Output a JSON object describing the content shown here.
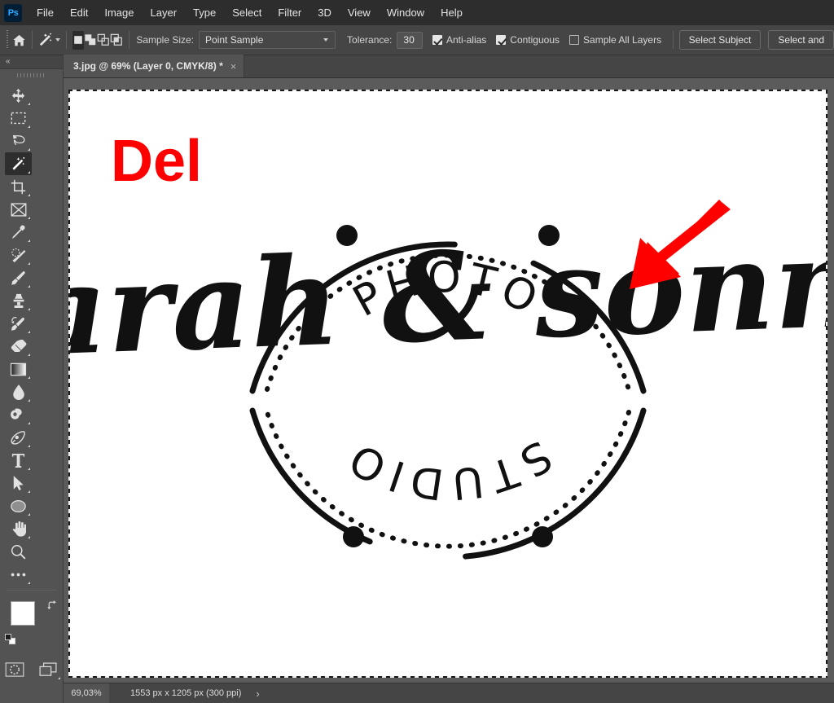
{
  "app": {
    "name": "Adobe Photoshop",
    "logo_text": "Ps"
  },
  "menubar": {
    "items": [
      {
        "label": "File"
      },
      {
        "label": "Edit"
      },
      {
        "label": "Image"
      },
      {
        "label": "Layer"
      },
      {
        "label": "Type"
      },
      {
        "label": "Select"
      },
      {
        "label": "Filter"
      },
      {
        "label": "3D"
      },
      {
        "label": "View"
      },
      {
        "label": "Window"
      },
      {
        "label": "Help"
      }
    ]
  },
  "options_bar": {
    "home_icon": "home-icon",
    "active_tool_icon": "magic-wand-icon",
    "selection_modes": [
      {
        "name": "new-selection",
        "active": true
      },
      {
        "name": "add-to-selection",
        "active": false
      },
      {
        "name": "subtract-from-selection",
        "active": false
      },
      {
        "name": "intersect-with-selection",
        "active": false
      }
    ],
    "sample_size_label": "Sample Size:",
    "sample_size_value": "Point Sample",
    "tolerance_label": "Tolerance:",
    "tolerance_value": "30",
    "anti_alias_label": "Anti-alias",
    "anti_alias_checked": true,
    "contiguous_label": "Contiguous",
    "contiguous_checked": true,
    "sample_all_layers_label": "Sample All Layers",
    "sample_all_layers_checked": false,
    "select_subject_label": "Select Subject",
    "select_and_mask_label": "Select and"
  },
  "toolbar": {
    "collapse_label": "«",
    "tools": [
      {
        "name": "move-tool",
        "label": "Move Tool",
        "active": false
      },
      {
        "name": "rectangular-marquee-tool",
        "label": "Rectangular Marquee Tool",
        "active": false
      },
      {
        "name": "lasso-tool",
        "label": "Lasso Tool",
        "active": false
      },
      {
        "name": "magic-wand-tool",
        "label": "Object Selection / Magic Wand Tool",
        "active": true
      },
      {
        "name": "crop-tool",
        "label": "Crop Tool",
        "active": false
      },
      {
        "name": "frame-tool",
        "label": "Frame Tool",
        "active": false
      },
      {
        "name": "eyedropper-tool",
        "label": "Eyedropper Tool",
        "active": false
      },
      {
        "name": "spot-healing-brush-tool",
        "label": "Spot Healing Brush Tool",
        "active": false
      },
      {
        "name": "brush-tool",
        "label": "Brush Tool",
        "active": false
      },
      {
        "name": "clone-stamp-tool",
        "label": "Clone Stamp Tool",
        "active": false
      },
      {
        "name": "history-brush-tool",
        "label": "History Brush Tool",
        "active": false
      },
      {
        "name": "eraser-tool",
        "label": "Eraser Tool",
        "active": false
      },
      {
        "name": "gradient-tool",
        "label": "Gradient Tool",
        "active": false
      },
      {
        "name": "blur-tool",
        "label": "Blur Tool",
        "active": false
      },
      {
        "name": "dodge-tool",
        "label": "Dodge Tool",
        "active": false
      },
      {
        "name": "pen-tool",
        "label": "Pen Tool",
        "active": false
      },
      {
        "name": "horizontal-type-tool",
        "label": "Horizontal Type Tool",
        "active": false
      },
      {
        "name": "path-selection-tool",
        "label": "Path Selection Tool",
        "active": false
      },
      {
        "name": "ellipse-tool",
        "label": "Ellipse Tool",
        "active": false
      },
      {
        "name": "hand-tool",
        "label": "Hand Tool",
        "active": false
      },
      {
        "name": "zoom-tool",
        "label": "Zoom Tool",
        "active": false
      },
      {
        "name": "edit-toolbar-tool",
        "label": "Edit Toolbar",
        "active": false
      }
    ],
    "foreground_color": "#ffffff",
    "background_color": "#ffffff",
    "quick_mask_label": "Edit in Quick Mask Mode",
    "screen_mode_label": "Change Screen Mode"
  },
  "document_tab": {
    "title": "3.jpg @ 69% (Layer 0, CMYK/8) *",
    "close_label": "×"
  },
  "canvas": {
    "annotation_text": "Del",
    "annotation_color": "#ff0000",
    "arrow_color": "#ff0000",
    "background_color": "#ffffff",
    "logo": {
      "top_arc_text": "PHOTO",
      "bottom_arc_text": "STUDIO",
      "script_text": "sarah & sonny",
      "ink_color": "#111111"
    }
  },
  "status_bar": {
    "zoom_level": "69,03%",
    "doc_dimensions": "1553 px x 1205 px (300 ppi)",
    "expand_label": "›"
  }
}
